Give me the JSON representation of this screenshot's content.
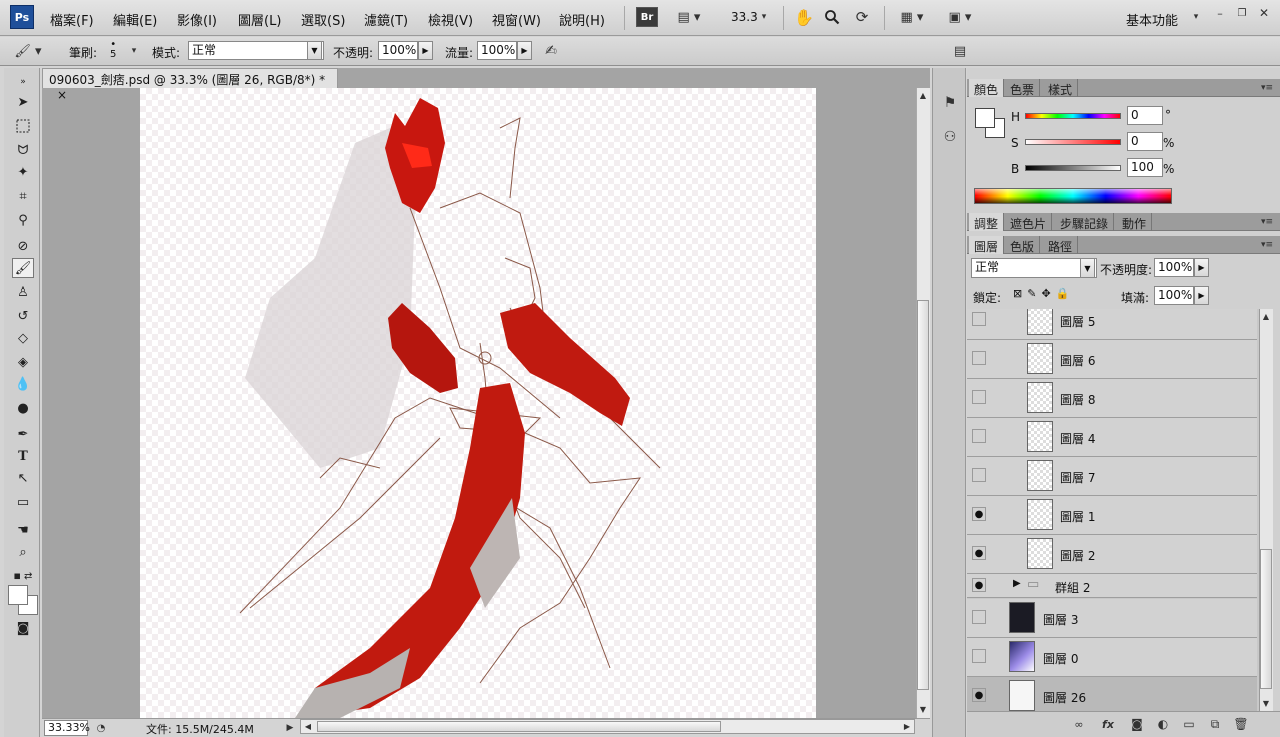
{
  "menubar": {
    "logo": "Ps",
    "items": [
      "檔案(F)",
      "編輯(E)",
      "影像(I)",
      "圖層(L)",
      "選取(S)",
      "濾鏡(T)",
      "檢視(V)",
      "視窗(W)",
      "說明(H)"
    ],
    "bridge_label": "Br",
    "zoom_value": "33.3",
    "workspace_label": "基本功能"
  },
  "options": {
    "brush_label": "筆刷:",
    "brush_size": "5",
    "mode_label": "模式:",
    "mode_value": "正常",
    "opacity_label": "不透明:",
    "opacity_value": "100%",
    "flow_label": "流量:",
    "flow_value": "100%"
  },
  "document": {
    "tab_title": "090603_劍痞.psd @ 33.3% (圖層 26, RGB/8*) *",
    "close_glyph": "×",
    "zoom_status": "33.33%",
    "file_info": "文件: 15.5M/245.4M"
  },
  "color_panel": {
    "tabs": [
      "顏色",
      "色票",
      "樣式"
    ],
    "h_label": "H",
    "h_value": "0",
    "h_unit": "°",
    "s_label": "S",
    "s_value": "0",
    "s_unit": "%",
    "b_label": "B",
    "b_value": "100",
    "b_unit": "%"
  },
  "adjust_panel": {
    "tabs": [
      "調整",
      "遮色片",
      "步驟記錄",
      "動作"
    ]
  },
  "layers_panel": {
    "tabs": [
      "圖層",
      "色版",
      "路徑"
    ],
    "blend_mode": "正常",
    "opacity_label": "不透明度:",
    "opacity_value": "100%",
    "lock_label": "鎖定:",
    "fill_label": "填滿:",
    "fill_value": "100%",
    "layers": [
      {
        "name": "圖層 5",
        "visible": false
      },
      {
        "name": "圖層 6",
        "visible": false
      },
      {
        "name": "圖層 8",
        "visible": false
      },
      {
        "name": "圖層 4",
        "visible": false
      },
      {
        "name": "圖層 7",
        "visible": false
      },
      {
        "name": "圖層 1",
        "visible": true
      },
      {
        "name": "圖層 2",
        "visible": true
      },
      {
        "name": "群組 2",
        "visible": true
      },
      {
        "name": "圖層 3",
        "visible": false
      },
      {
        "name": "圖層 0",
        "visible": false
      },
      {
        "name": "圖層 26",
        "visible": true
      }
    ],
    "footer_icons": [
      "link-icon",
      "fx-icon",
      "mask-icon",
      "adjustment-icon",
      "folder-icon",
      "new-layer-icon",
      "trash-icon"
    ],
    "fx_label": "fx"
  },
  "colors": {
    "accent": "#1f4f9a",
    "paint_red": "#c8170f",
    "line_brown": "#8a5848"
  }
}
